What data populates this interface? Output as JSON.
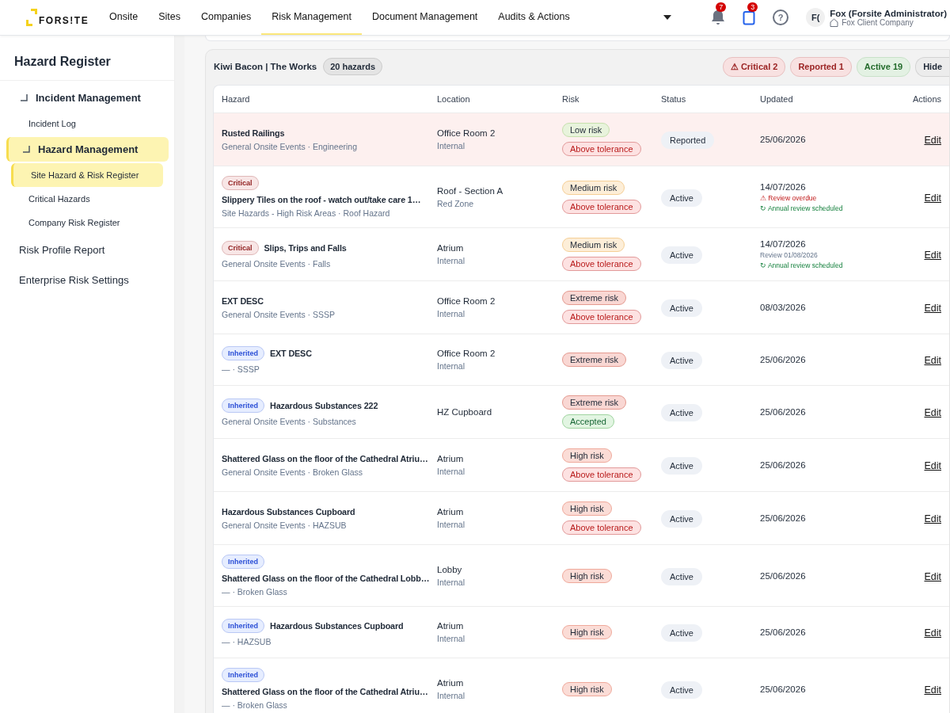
{
  "topbar": {
    "logo": "FORS!TE",
    "nav": [
      {
        "label": "Onsite",
        "selected": false
      },
      {
        "label": "Sites",
        "selected": false
      },
      {
        "label": "Companies",
        "selected": false
      },
      {
        "label": "Risk Management",
        "selected": true
      },
      {
        "label": "Document Management",
        "selected": false
      },
      {
        "label": "Audits & Actions",
        "selected": false
      }
    ],
    "notifications": "7",
    "tasks": "3",
    "help": "?",
    "avatar": "F(",
    "user_name": "Fox (Forsite Administrator)",
    "company": "Fox Client Company"
  },
  "sidebar": {
    "title": "Hazard Register",
    "items": [
      {
        "label": "Incident Management",
        "expanded": true,
        "selected": false,
        "children": [
          {
            "label": "Incident Log",
            "selected": false
          }
        ]
      },
      {
        "label": "Hazard Management",
        "expanded": true,
        "selected": true,
        "children": [
          {
            "label": "Site Hazard & Risk Register",
            "selected": true
          },
          {
            "label": "Critical Hazards",
            "selected": false
          },
          {
            "label": "Company Risk Register",
            "selected": false
          }
        ]
      },
      {
        "label": "Risk Profile Report",
        "selected": false
      },
      {
        "label": "Enterprise Risk Settings",
        "selected": false
      }
    ]
  },
  "panel": {
    "site": "Kiwi Bacon | The Works",
    "count": "20 hazards",
    "filters": [
      {
        "label": "⚠ Critical 2",
        "kind": "critical"
      },
      {
        "label": "Reported 1",
        "kind": "reported"
      },
      {
        "label": "Active 19",
        "kind": "active"
      },
      {
        "label": "Hide",
        "kind": "button"
      }
    ],
    "table": {
      "columns": [
        "Hazard",
        "Location",
        "Risk",
        "Status",
        "Updated",
        "Actions"
      ],
      "rows": [
        {
          "highlighted": true,
          "title": "Rusted Railings",
          "category": "General Onsite Events · Engineering",
          "location": "Office Room 2",
          "area": "Internal",
          "risks": [
            {
              "label": "Low risk",
              "kind": "low"
            },
            {
              "label": "Above tolerance",
              "kind": "above"
            }
          ],
          "status": "Reported",
          "updated": "25/06/2026",
          "action": "Edit"
        },
        {
          "highlighted": false,
          "tag": {
            "label": "Critical",
            "kind": "critical"
          },
          "title": "Slippery Tiles on the roof - watch out/take care 1…",
          "category": "Site Hazards - High Risk Areas · Roof Hazard",
          "location": "Roof - Section A",
          "area": "Red Zone",
          "risks": [
            {
              "label": "Medium risk",
              "kind": "medium"
            },
            {
              "label": "Above tolerance",
              "kind": "above"
            }
          ],
          "status": "Active",
          "updated": "14/07/2026",
          "notes": [
            {
              "label": "⚠ Review overdue",
              "kind": "overdue"
            },
            {
              "label": "↻ Annual review scheduled",
              "kind": "scheduled"
            }
          ],
          "action": "Edit"
        },
        {
          "highlighted": false,
          "tag": {
            "label": "Critical",
            "kind": "critical"
          },
          "title": "Slips, Trips and Falls",
          "category": "General Onsite Events · Falls",
          "location": "Atrium",
          "area": "Internal",
          "risks": [
            {
              "label": "Medium risk",
              "kind": "medium"
            },
            {
              "label": "Above tolerance",
              "kind": "above"
            }
          ],
          "status": "Active",
          "updated": "14/07/2026",
          "notes": [
            {
              "label": "Review 01/08/2026",
              "kind": "review"
            },
            {
              "label": "↻ Annual review scheduled",
              "kind": "scheduled"
            }
          ],
          "action": "Edit"
        },
        {
          "highlighted": false,
          "title": "EXT DESC",
          "category": "General Onsite Events · SSSP",
          "location": "Office Room 2",
          "area": "Internal",
          "risks": [
            {
              "label": "Extreme risk",
              "kind": "extreme"
            },
            {
              "label": "Above tolerance",
              "kind": "above"
            }
          ],
          "status": "Active",
          "updated": "08/03/2026",
          "action": "Edit"
        },
        {
          "highlighted": false,
          "tag": {
            "label": "Inherited",
            "kind": "inherited"
          },
          "title": "EXT DESC",
          "category": "— · SSSP",
          "location": "Office Room 2",
          "area": "Internal",
          "risks": [
            {
              "label": "Extreme risk",
              "kind": "extreme"
            }
          ],
          "status": "Active",
          "updated": "25/06/2026",
          "action": "Edit"
        },
        {
          "highlighted": false,
          "tag": {
            "label": "Inherited",
            "kind": "inherited"
          },
          "title": "Hazardous Substances 222",
          "category": "General Onsite Events · Substances",
          "location": "HZ Cupboard",
          "risks": [
            {
              "label": "Extreme risk",
              "kind": "extreme"
            },
            {
              "label": "Accepted",
              "kind": "accepted"
            }
          ],
          "status": "Active",
          "updated": "25/06/2026",
          "action": "Edit"
        },
        {
          "highlighted": false,
          "title": "Shattered Glass on the floor of the Cathedral Atriu…",
          "category": "General Onsite Events · Broken Glass",
          "location": "Atrium",
          "area": "Internal",
          "risks": [
            {
              "label": "High risk",
              "kind": "high"
            },
            {
              "label": "Above tolerance",
              "kind": "above"
            }
          ],
          "status": "Active",
          "updated": "25/06/2026",
          "action": "Edit"
        },
        {
          "highlighted": false,
          "title": "Hazardous Substances Cupboard",
          "category": "General Onsite Events · HAZSUB",
          "location": "Atrium",
          "area": "Internal",
          "risks": [
            {
              "label": "High risk",
              "kind": "high"
            },
            {
              "label": "Above tolerance",
              "kind": "above"
            }
          ],
          "status": "Active",
          "updated": "25/06/2026",
          "action": "Edit"
        },
        {
          "highlighted": false,
          "tag": {
            "label": "Inherited",
            "kind": "inherited"
          },
          "title": "Shattered Glass on the floor of the Cathedral Lobb…",
          "category": "— · Broken Glass",
          "location": "Lobby",
          "area": "Internal",
          "risks": [
            {
              "label": "High risk",
              "kind": "high"
            }
          ],
          "status": "Active",
          "updated": "25/06/2026",
          "action": "Edit"
        },
        {
          "highlighted": false,
          "tag": {
            "label": "Inherited",
            "kind": "inherited"
          },
          "title": "Hazardous Substances Cupboard",
          "category": "— · HAZSUB",
          "location": "Atrium",
          "area": "Internal",
          "risks": [
            {
              "label": "High risk",
              "kind": "high"
            }
          ],
          "status": "Active",
          "updated": "25/06/2026",
          "action": "Edit"
        },
        {
          "highlighted": false,
          "tag": {
            "label": "Inherited",
            "kind": "inherited"
          },
          "title": "Shattered Glass on the floor of the Cathedral Atriu…",
          "category": "— · Broken Glass",
          "location": "Atrium",
          "area": "Internal",
          "risks": [
            {
              "label": "High risk",
              "kind": "high"
            }
          ],
          "status": "Active",
          "updated": "25/06/2026",
          "action": "Edit"
        }
      ]
    }
  }
}
